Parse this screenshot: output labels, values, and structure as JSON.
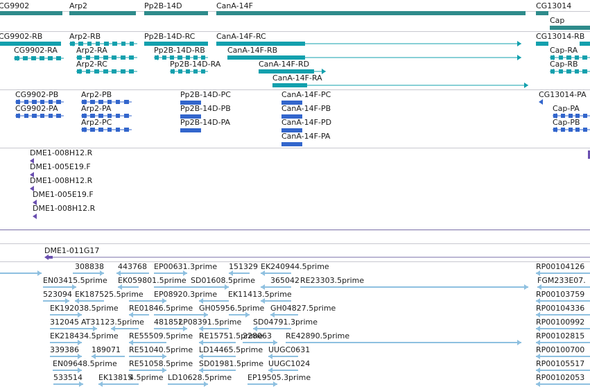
{
  "colors": {
    "gene": "#2e8b8b",
    "mrna": "#12a0ad",
    "cds": "#3366cc",
    "bac": "#6a4fb0",
    "est": "#8ec0e0",
    "separator_dark": "#7a6fa8",
    "separator_light": "#c8c8d0"
  },
  "tracks": {
    "genes": [
      "CG9902",
      "Arp2",
      "Pp2B-14D",
      "CanA-14F",
      "CG13014",
      "Cap"
    ],
    "transcripts": [
      "CG9902-RB",
      "CG9902-RA",
      "Arp2-RB",
      "Arp2-RA",
      "Arp2-RC",
      "Pp2B-14D-RC",
      "Pp2B-14D-RB",
      "Pp2B-14D-RA",
      "CanA-14F-RC",
      "CanA-14F-RB",
      "CanA-14F-RD",
      "CanA-14F-RA",
      "CG13014-RB",
      "Cap-RA",
      "Cap-RB"
    ],
    "proteins": [
      "CG9902-PB",
      "CG9902-PA",
      "Arp2-PB",
      "Arp2-PA",
      "Arp2-PC",
      "Pp2B-14D-PC",
      "Pp2B-14D-PB",
      "Pp2B-14D-PA",
      "CanA-14F-PC",
      "CanA-14F-PB",
      "CanA-14F-PD",
      "CanA-14F-PA",
      "CG13014-PA",
      "Cap-PA",
      "Cap-PB"
    ],
    "bac_ends": [
      "DME1-008H12.R",
      "DME1-005E19.F",
      "DME1-008H12.R",
      "DME1-005E19.F",
      "DME1-008H12.R"
    ],
    "bac_clone": [
      "DME1-011G17"
    ],
    "ests": [
      "308838",
      "443768",
      "EP00631.3prime",
      "151329",
      "EK240944.5prime",
      "RP00104126",
      "EN03415.5prime",
      "EK059801.5prime",
      "SD01608.5prime",
      "365042",
      "RE23303.5prime",
      "FGM233E07.",
      "523094",
      "EK187525.5prime",
      "EP08920.3prime",
      "EK11413.5prime",
      "RP00103759",
      "EK192038.5prime",
      "RE01846.5prime",
      "GH05956.5prime",
      "GH04827.5prime",
      "RP00104336",
      "312045",
      "AT31123.5prime",
      "481852",
      "LP08391.5prime",
      "SD04791.3prime",
      "RP00100992",
      "EK218434.5prime",
      "RE55509.5prime",
      "RE15751.5prime",
      "228063",
      "RE42890.5prime",
      "RP00102815",
      "339386",
      "189071",
      "RE51040.5prime",
      "LD14465.5prime",
      "UUGC0631",
      "RP00100700",
      "EN09648.5prime",
      "RE51058.5prime",
      "SD01981.5prime",
      "UUGC1024",
      "RP00105517",
      "533514",
      "EK13815",
      "4.5prime",
      "LD10628.5prime",
      "EP19505.3prime",
      "RP00102053"
    ]
  }
}
